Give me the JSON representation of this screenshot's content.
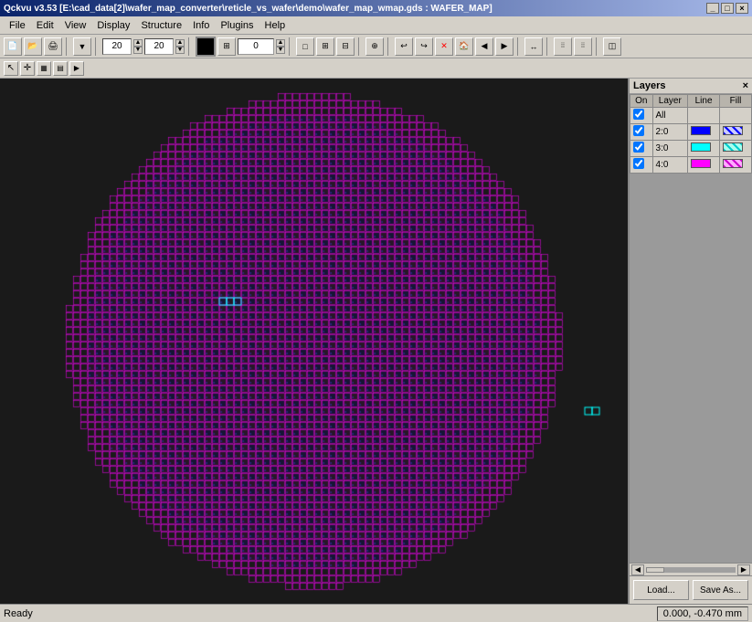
{
  "titlebar": {
    "title": "Qckvu v3.53 [E:\\cad_data[2]\\wafer_map_converter\\reticle_vs_wafer\\demo\\wafer_map_wmap.gds : WAFER_MAP]",
    "minimize": "_",
    "maximize": "□",
    "close": "×"
  },
  "menubar": {
    "items": [
      "File",
      "Edit",
      "View",
      "Display",
      "Structure",
      "Info",
      "Plugins",
      "Help"
    ]
  },
  "toolbar": {
    "zoom_value1": "20",
    "zoom_value2": "20",
    "counter_value": "0"
  },
  "layers": {
    "title": "Layers",
    "columns": [
      "On",
      "Layer",
      "Line",
      "Fill"
    ],
    "rows": [
      {
        "on": true,
        "layer": "All",
        "line_color": "",
        "fill_color": "",
        "is_all": true
      },
      {
        "on": true,
        "layer": "2:0",
        "line_color": "#0000ff",
        "fill_color": "#ccccff"
      },
      {
        "on": true,
        "layer": "3:0",
        "line_color": "#00ffff",
        "fill_color": "#aaffee"
      },
      {
        "on": true,
        "layer": "4:0",
        "line_color": "#ff00ff",
        "fill_color": "#ffaaff"
      }
    ],
    "load_btn": "Load...",
    "save_btn": "Save As..."
  },
  "statusbar": {
    "ready": "Ready",
    "coords": "0.000, -0.470 mm"
  },
  "wafer": {
    "background": "#1a1a1a",
    "grid_color_magenta": "#ff00ff",
    "grid_color_blue": "#0000dd",
    "grid_color_cyan": "#00eeee"
  }
}
